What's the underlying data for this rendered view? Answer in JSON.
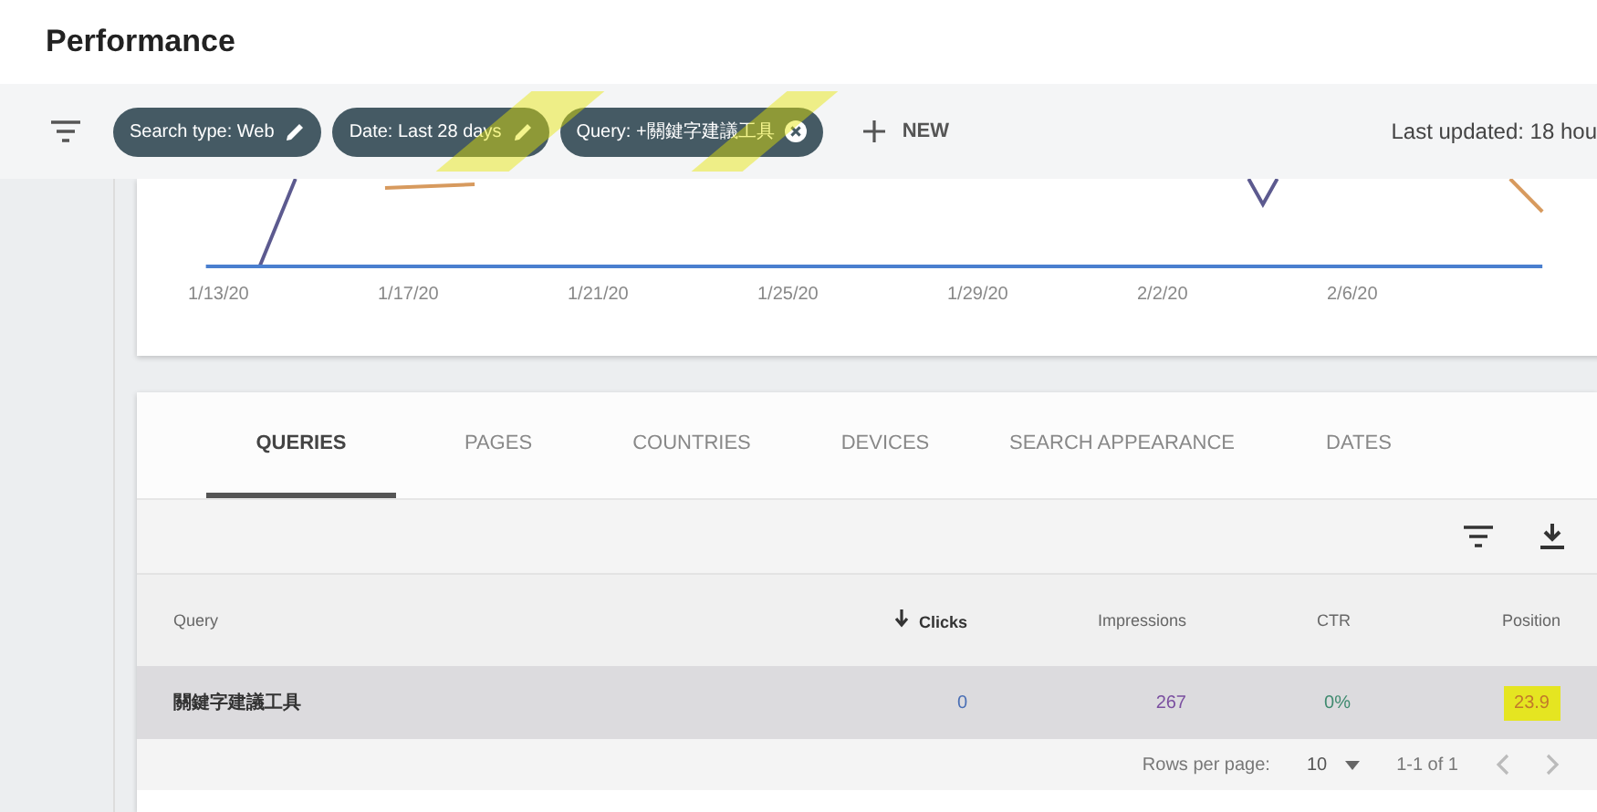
{
  "header": {
    "title": "Performance"
  },
  "filters": {
    "chips": [
      {
        "label": "Search type: Web",
        "kind": "edit"
      },
      {
        "label": "Date: Last 28 days",
        "kind": "edit"
      },
      {
        "label": "Query: +關鍵字建議工具",
        "kind": "remove"
      }
    ],
    "new_label": "NEW",
    "updated": "Last updated: 18 hou"
  },
  "chart": {
    "x_labels": [
      "1/13/20",
      "1/17/20",
      "1/21/20",
      "1/25/20",
      "1/29/20",
      "2/2/20",
      "2/6/20"
    ]
  },
  "tabs": [
    {
      "label": "QUERIES",
      "selected": true
    },
    {
      "label": "PAGES",
      "selected": false
    },
    {
      "label": "COUNTRIES",
      "selected": false
    },
    {
      "label": "DEVICES",
      "selected": false
    },
    {
      "label": "SEARCH APPEARANCE",
      "selected": false
    },
    {
      "label": "DATES",
      "selected": false
    }
  ],
  "table": {
    "columns": [
      {
        "label": "Query",
        "sorted": false
      },
      {
        "label": "Clicks",
        "sorted": true
      },
      {
        "label": "Impressions",
        "sorted": false
      },
      {
        "label": "CTR",
        "sorted": false
      },
      {
        "label": "Position",
        "sorted": false
      }
    ],
    "rows": [
      {
        "cells": [
          "關鍵字建議工具",
          "0",
          "267",
          "0%",
          "23.9"
        ]
      }
    ]
  },
  "pagination": {
    "rows_label": "Rows per page:",
    "rows_value": "10",
    "range": "1-1 of 1"
  }
}
